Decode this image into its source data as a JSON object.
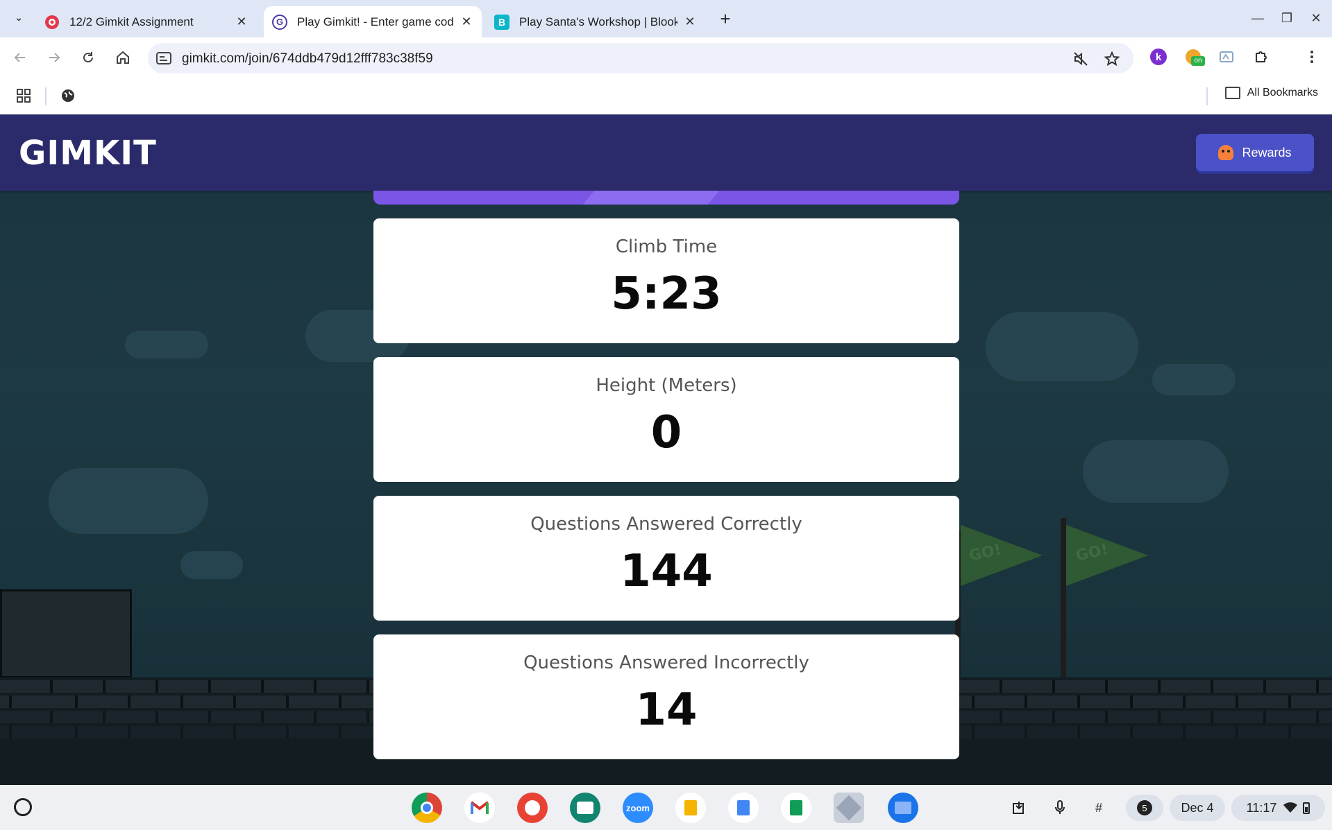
{
  "browser": {
    "tabs": [
      {
        "title": "12/2 Gimkit Assignment",
        "favicon": "canvas-icon",
        "active": false
      },
      {
        "title": "Play Gimkit! - Enter game code",
        "favicon": "gimkit-icon",
        "active": true
      },
      {
        "title": "Play Santa's Workshop | Blooket",
        "favicon": "blooket-icon",
        "active": false
      }
    ],
    "url": {
      "domain": "gimkit.com",
      "path": "/join/674ddb479d12fff783c38f59"
    },
    "bookmarks": {
      "all_label": "All Bookmarks"
    },
    "extensions": [
      "k-extension-icon",
      "on-extension-icon",
      "cast-icon",
      "puzzle-icon"
    ]
  },
  "gimkit": {
    "logo": "GIMKIT",
    "rewards_label": "Rewards",
    "stats": [
      {
        "label": "Climb Time",
        "value": "5:23"
      },
      {
        "label": "Height (Meters)",
        "value": "0"
      },
      {
        "label": "Questions Answered Correctly",
        "value": "144"
      },
      {
        "label": "Questions Answered Incorrectly",
        "value": "14"
      }
    ],
    "scenery": {
      "flag_text": "GO!"
    }
  },
  "shelf": {
    "apps": [
      "chrome-icon",
      "gmail-icon",
      "canvas-paint-icon",
      "classroom-icon",
      "zoom-icon",
      "slides-icon",
      "docs-icon",
      "sheets-icon",
      "app-icon",
      "files-icon"
    ],
    "zoom_label": "zoom",
    "notifications": "5",
    "date": "Dec 4",
    "time": "11:17"
  },
  "colors": {
    "gimkit_header": "#2b2b6b",
    "rewards_button": "#4b52c8",
    "accent_purple": "#7a55e6",
    "browser_frame": "#dfe7f7"
  }
}
